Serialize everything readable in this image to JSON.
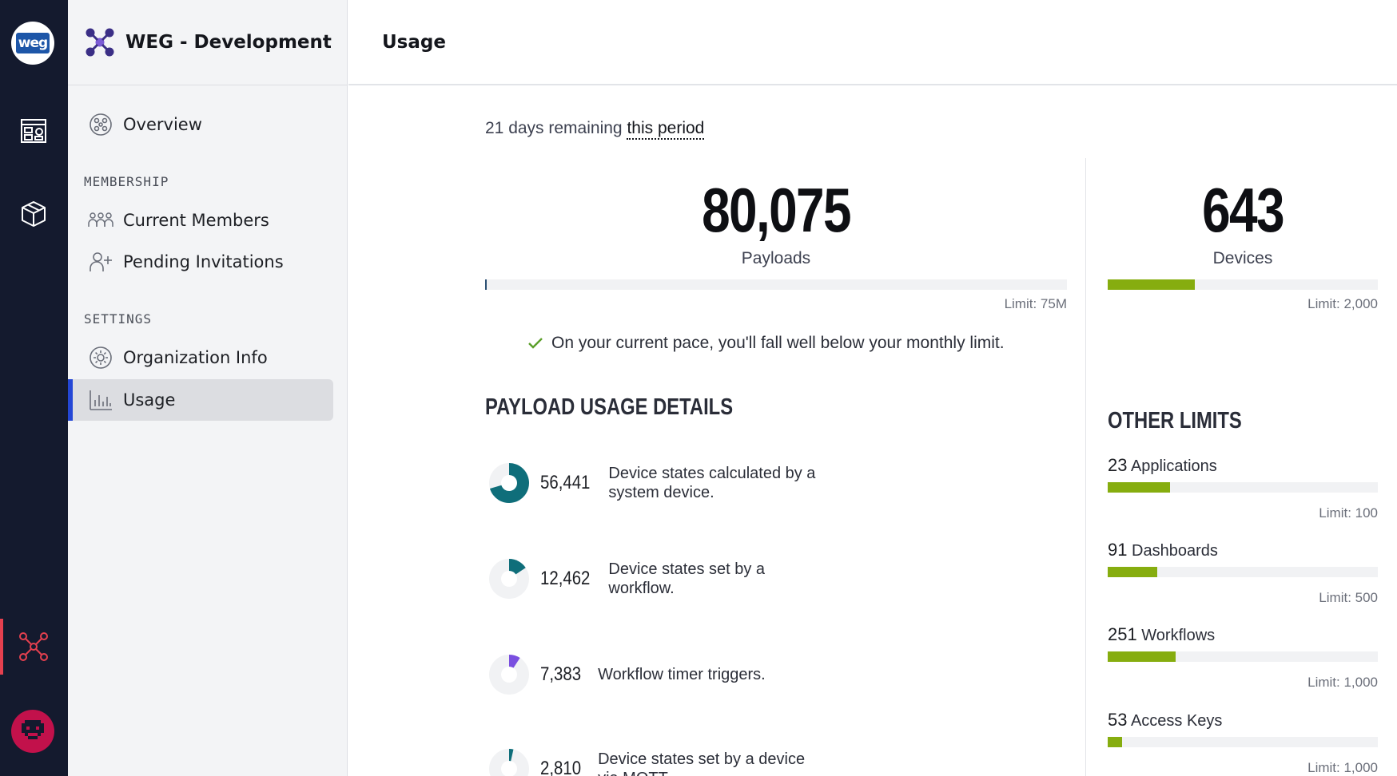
{
  "rail": {
    "logo_text": "weg",
    "items": [
      {
        "name": "dashboards",
        "icon": "dashboard-layout-icon"
      },
      {
        "name": "applications",
        "icon": "cube-icon"
      },
      {
        "name": "organization",
        "icon": "organization-network-icon"
      }
    ],
    "avatar_icon": "user-avatar-icon"
  },
  "sidebar": {
    "org_name": "WEG - Development",
    "overview_label": "Overview",
    "membership_heading": "MEMBERSHIP",
    "current_members_label": "Current Members",
    "pending_invitations_label": "Pending Invitations",
    "settings_heading": "SETTINGS",
    "organization_info_label": "Organization Info",
    "usage_label": "Usage"
  },
  "topbar": {
    "title": "Usage"
  },
  "period": {
    "prefix": "21 days remaining",
    "link": "this period"
  },
  "payloads": {
    "value": "80,075",
    "label": "Payloads",
    "limit": "Limit: 75M",
    "fraction": 0.00107
  },
  "devices": {
    "value": "643",
    "label": "Devices",
    "limit": "Limit: 2,000",
    "fraction": 0.3215
  },
  "pace_message": "On your current pace, you'll fall well below your monthly limit.",
  "payload_details": {
    "heading": "PAYLOAD USAGE DETAILS",
    "items": [
      {
        "value": "56,441",
        "desc1": "Device states calculated by a",
        "desc2": "system device.",
        "fraction": 0.705,
        "color": "#0f6e7a"
      },
      {
        "value": "12,462",
        "desc1": "Device states set by a",
        "desc2": "workflow.",
        "fraction": 0.156,
        "color": "#0f6e7a"
      },
      {
        "value": "7,383",
        "desc1": "Workflow timer triggers.",
        "desc2": "",
        "fraction": 0.092,
        "color": "#7a4fe0"
      },
      {
        "value": "2,810",
        "desc1": "Device states set by a device",
        "desc2": "via MQTT.",
        "fraction": 0.035,
        "color": "#0f6e7a"
      }
    ]
  },
  "other_limits": {
    "heading": "OTHER LIMITS",
    "items": [
      {
        "value": "23",
        "label": "Applications",
        "limit": "Limit: 100",
        "fraction": 0.23
      },
      {
        "value": "91",
        "label": "Dashboards",
        "limit": "Limit: 500",
        "fraction": 0.182
      },
      {
        "value": "251",
        "label": "Workflows",
        "limit": "Limit: 1,000",
        "fraction": 0.251
      },
      {
        "value": "53",
        "label": "Access Keys",
        "limit": "Limit: 1,000",
        "fraction": 0.053
      }
    ]
  },
  "colors": {
    "rail_bg": "#141a2e",
    "accent_blue": "#2447d6",
    "progress_green": "#86ad0f",
    "active_red": "#e5404f"
  }
}
